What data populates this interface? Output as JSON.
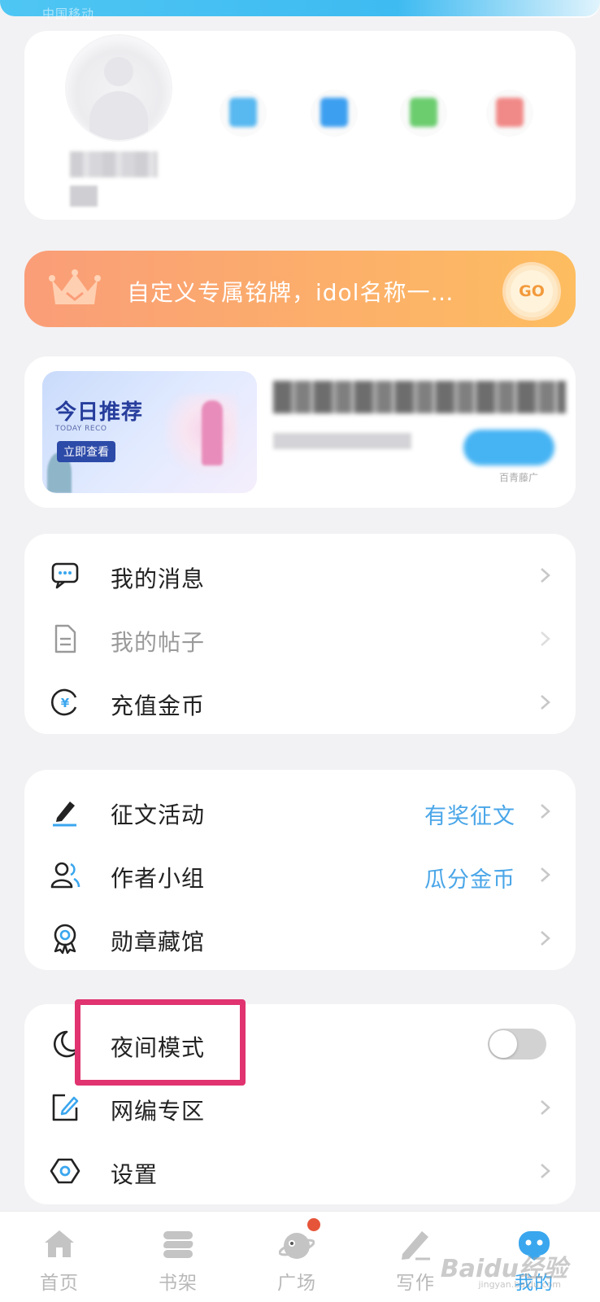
{
  "status_bar": {
    "carrier": "中国移动"
  },
  "profile": {
    "name_partial": "册"
  },
  "promo": {
    "text": "自定义专属铭牌，idol名称一…",
    "go_label": "GO"
  },
  "recommend": {
    "image_title": "今日推荐",
    "image_subtitle": "TODAY RECO",
    "image_button": "立即查看",
    "source": "百青藤广"
  },
  "menu_group_1": [
    {
      "label": "我的消息",
      "icon": "message-icon"
    },
    {
      "label": "我的帖子",
      "icon": "document-icon"
    },
    {
      "label": "充值金币",
      "icon": "coin-icon"
    }
  ],
  "menu_group_2": [
    {
      "label": "征文活动",
      "tag": "有奖征文",
      "icon": "pen-icon"
    },
    {
      "label": "作者小组",
      "tag": "瓜分金币",
      "icon": "group-icon"
    },
    {
      "label": "勋章藏馆",
      "icon": "medal-icon"
    }
  ],
  "menu_group_3": [
    {
      "label": "夜间模式",
      "icon": "moon-icon",
      "toggle_on": false
    },
    {
      "label": "网编专区",
      "icon": "edit-icon"
    },
    {
      "label": "设置",
      "icon": "settings-icon"
    }
  ],
  "tabs": [
    {
      "label": "首页",
      "icon": "home-icon"
    },
    {
      "label": "书架",
      "icon": "bookshelf-icon"
    },
    {
      "label": "广场",
      "icon": "plaza-icon"
    },
    {
      "label": "写作",
      "icon": "write-icon"
    },
    {
      "label": "我的",
      "icon": "profile-icon"
    }
  ],
  "watermark": {
    "brand": "Baidu经验",
    "url": "jingyan.baidu.com"
  },
  "colors": {
    "accent": "#3aa6ee",
    "highlight": "#e0336f",
    "promo_start": "#fa9d78",
    "promo_end": "#fdbd60"
  }
}
